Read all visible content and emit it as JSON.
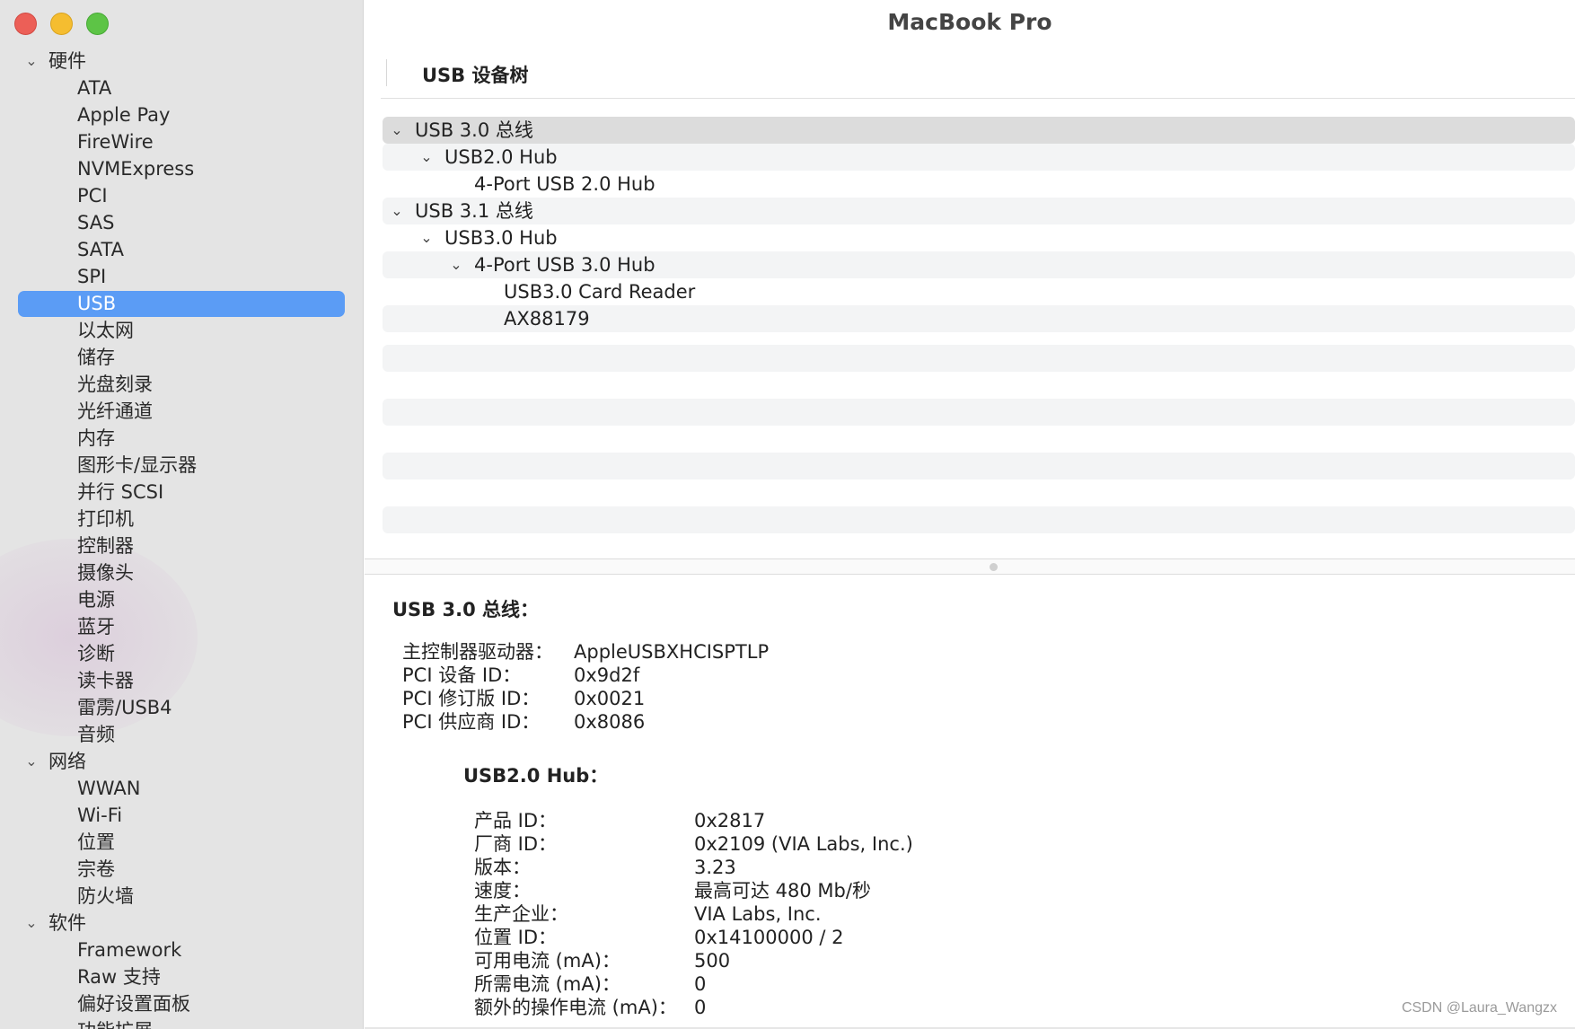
{
  "window": {
    "title": "MacBook Pro"
  },
  "sidebar": {
    "items": [
      {
        "label": "硬件",
        "type": "group"
      },
      {
        "label": "ATA",
        "type": "child"
      },
      {
        "label": "Apple Pay",
        "type": "child"
      },
      {
        "label": "FireWire",
        "type": "child"
      },
      {
        "label": "NVMExpress",
        "type": "child"
      },
      {
        "label": "PCI",
        "type": "child"
      },
      {
        "label": "SAS",
        "type": "child"
      },
      {
        "label": "SATA",
        "type": "child"
      },
      {
        "label": "SPI",
        "type": "child"
      },
      {
        "label": "USB",
        "type": "child",
        "selected": true
      },
      {
        "label": "以太网",
        "type": "child"
      },
      {
        "label": "储存",
        "type": "child"
      },
      {
        "label": "光盘刻录",
        "type": "child"
      },
      {
        "label": "光纤通道",
        "type": "child"
      },
      {
        "label": "内存",
        "type": "child"
      },
      {
        "label": "图形卡/显示器",
        "type": "child"
      },
      {
        "label": "并行 SCSI",
        "type": "child"
      },
      {
        "label": "打印机",
        "type": "child"
      },
      {
        "label": "控制器",
        "type": "child"
      },
      {
        "label": "摄像头",
        "type": "child"
      },
      {
        "label": "电源",
        "type": "child"
      },
      {
        "label": "蓝牙",
        "type": "child"
      },
      {
        "label": "诊断",
        "type": "child"
      },
      {
        "label": "读卡器",
        "type": "child"
      },
      {
        "label": "雷雳/USB4",
        "type": "child"
      },
      {
        "label": "音频",
        "type": "child"
      },
      {
        "label": "网络",
        "type": "group"
      },
      {
        "label": "WWAN",
        "type": "child"
      },
      {
        "label": "Wi-Fi",
        "type": "child"
      },
      {
        "label": "位置",
        "type": "child"
      },
      {
        "label": "宗卷",
        "type": "child"
      },
      {
        "label": "防火墙",
        "type": "child"
      },
      {
        "label": "软件",
        "type": "group"
      },
      {
        "label": "Framework",
        "type": "child"
      },
      {
        "label": "Raw 支持",
        "type": "child"
      },
      {
        "label": "偏好设置面板",
        "type": "child"
      },
      {
        "label": "功能扩展",
        "type": "child"
      }
    ]
  },
  "pane": {
    "header": "USB 设备树"
  },
  "tree": {
    "rows": [
      {
        "label": "USB 3.0 总线",
        "level": 0,
        "expanded": true,
        "selected": true
      },
      {
        "label": "USB2.0 Hub",
        "level": 1,
        "expanded": true
      },
      {
        "label": "4-Port USB 2.0 Hub",
        "level": 2,
        "expanded": false
      },
      {
        "label": "USB 3.1 总线",
        "level": 0,
        "expanded": true
      },
      {
        "label": "USB3.0 Hub",
        "level": 1,
        "expanded": true
      },
      {
        "label": "4-Port USB 3.0 Hub",
        "level": 2,
        "expanded": true
      },
      {
        "label": "USB3.0 Card Reader",
        "level": 3,
        "expanded": false
      },
      {
        "label": "AX88179",
        "level": 3,
        "expanded": false
      }
    ]
  },
  "details": {
    "section_title": "USB 3.0 总线：",
    "fields": [
      {
        "key": "主控制器驱动器：",
        "value": "AppleUSBXHCISPTLP"
      },
      {
        "key": "PCI 设备 ID：",
        "value": "0x9d2f"
      },
      {
        "key": "PCI 修订版 ID：",
        "value": "0x0021"
      },
      {
        "key": "PCI 供应商 ID：",
        "value": "0x8086"
      }
    ],
    "sub_title": "USB2.0 Hub：",
    "sub_fields": [
      {
        "key": "产品 ID：",
        "value": "0x2817"
      },
      {
        "key": "厂商 ID：",
        "value": "0x2109  (VIA Labs, Inc.)"
      },
      {
        "key": "版本：",
        "value": "3.23"
      },
      {
        "key": "速度：",
        "value": "最高可达 480 Mb/秒"
      },
      {
        "key": "生产企业：",
        "value": "VIA Labs, Inc."
      },
      {
        "key": "位置 ID：",
        "value": "0x14100000 / 2"
      },
      {
        "key": "可用电流 (mA)：",
        "value": "500"
      },
      {
        "key": "所需电流 (mA)：",
        "value": "0"
      },
      {
        "key": "额外的操作电流 (mA)：",
        "value": "0"
      }
    ]
  },
  "watermark": "CSDN @Laura_Wangzx",
  "colors": {
    "selection": "#5b9cf5",
    "sidebar_bg": "#e4e4e4",
    "close": "#ec5f57",
    "minimize": "#f5bd30",
    "zoom": "#5dc446"
  }
}
